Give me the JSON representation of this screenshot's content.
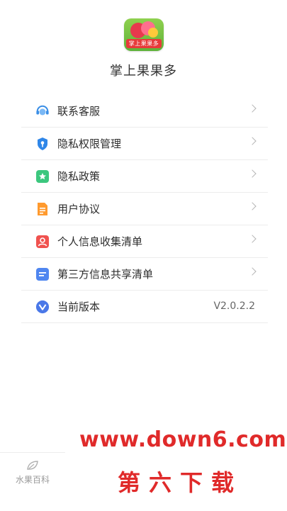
{
  "app": {
    "logo_text": "掌上果果多",
    "name": "掌上果果多"
  },
  "menu": {
    "items": [
      {
        "label": "联系客服",
        "icon": "customer-service-icon"
      },
      {
        "label": "隐私权限管理",
        "icon": "shield-key-icon"
      },
      {
        "label": "隐私政策",
        "icon": "policy-bookmark-icon"
      },
      {
        "label": "用户协议",
        "icon": "document-icon"
      },
      {
        "label": "个人信息收集清单",
        "icon": "person-card-icon"
      },
      {
        "label": "第三方信息共享清单",
        "icon": "list-doc-icon"
      },
      {
        "label": "当前版本",
        "icon": "version-v-icon",
        "value": "V2.0.2.2"
      }
    ]
  },
  "bottom_tab": {
    "label": "水果百科",
    "icon": "leaf-icon"
  },
  "watermark": {
    "url": "www.down6.com",
    "text": "第六下载"
  },
  "colors": {
    "accent_red": "#e02a2a",
    "divider": "#ececec"
  }
}
